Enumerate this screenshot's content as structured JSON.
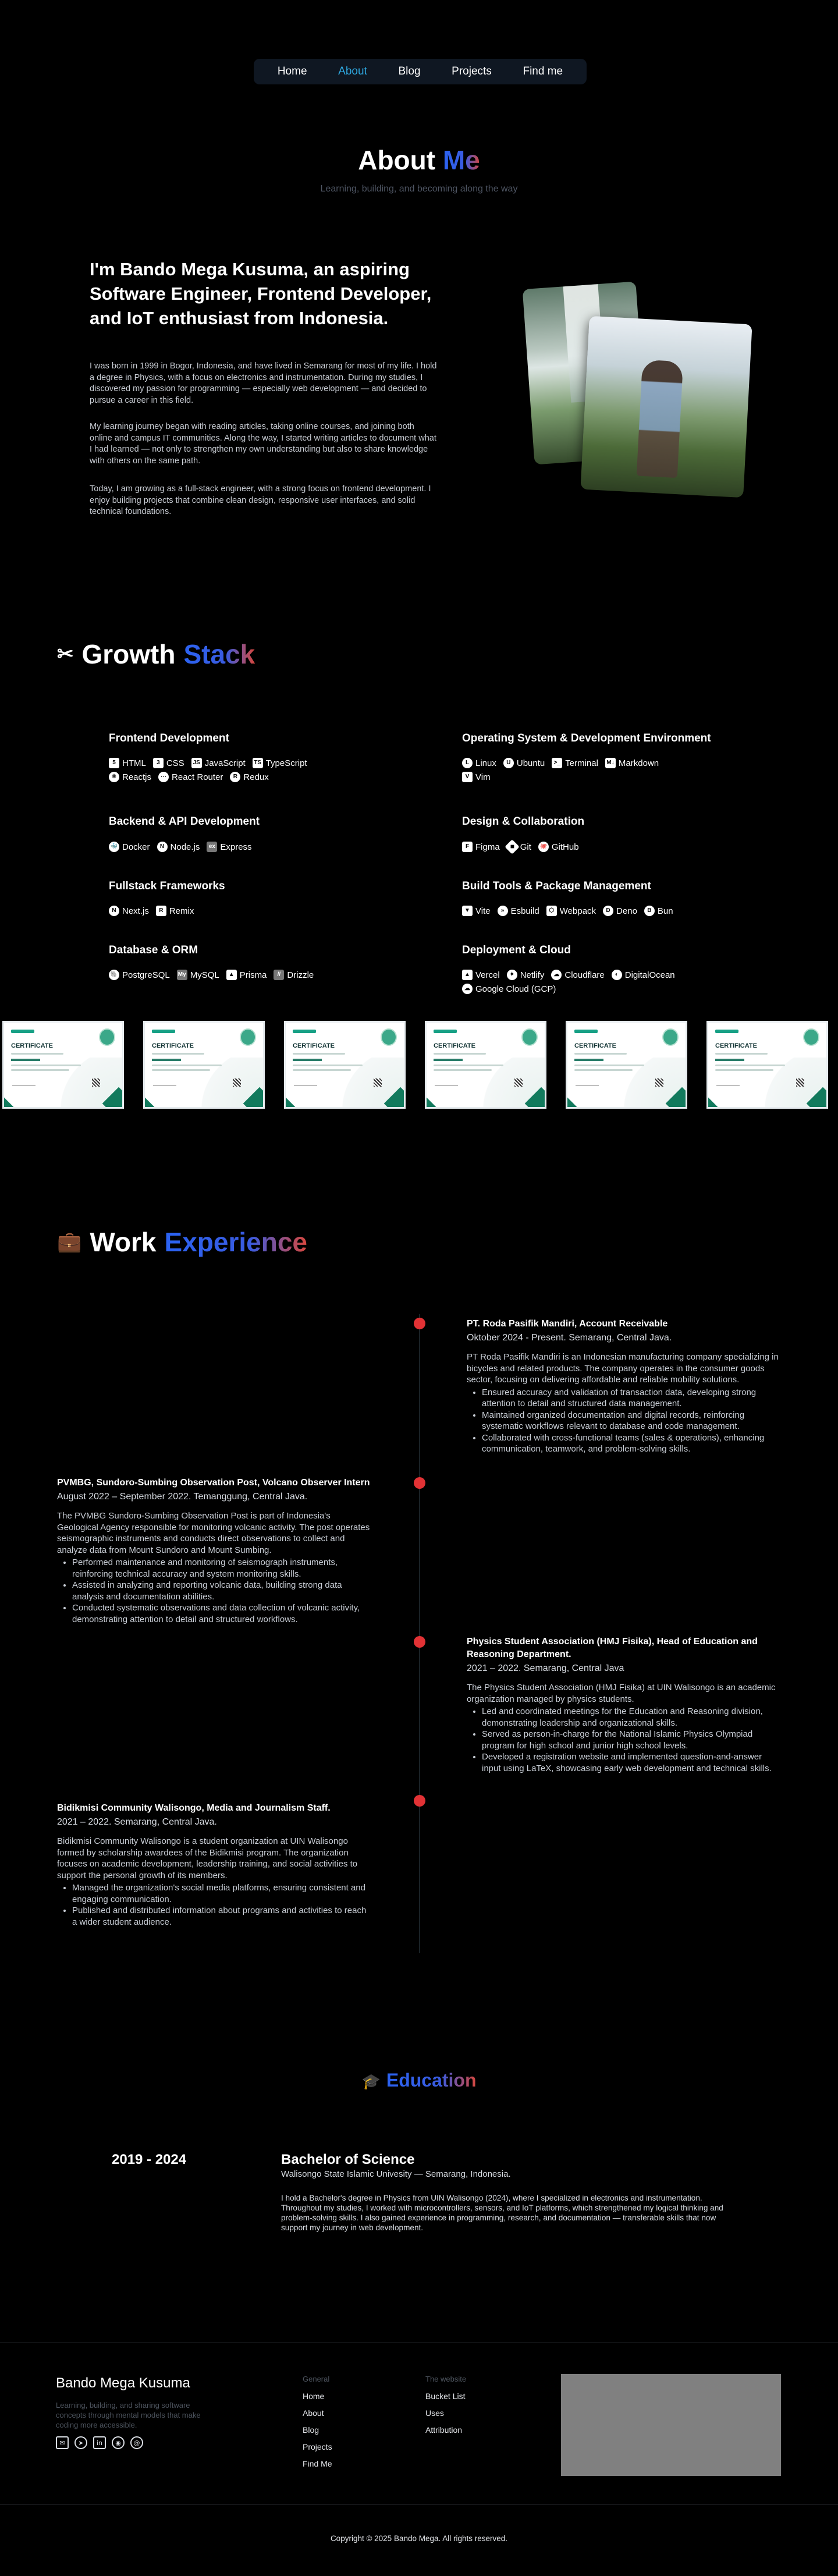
{
  "nav": {
    "items": [
      "Home",
      "About",
      "Blog",
      "Projects",
      "Find me"
    ],
    "active": "About"
  },
  "about": {
    "title_a": "About",
    "title_b": "Me",
    "subtitle": "Learning, building, and becoming along the way",
    "heading": "I'm Bando Mega Kusuma, an aspiring Software Engineer, Frontend Developer, and IoT enthusiast from Indonesia.",
    "paragraphs": [
      "I was born in 1999 in Bogor, Indonesia, and have lived in Semarang for most of my life. I hold a degree in Physics, with a focus on electronics and instrumentation. During my studies, I discovered my passion for programming — especially web development — and decided to pursue a career in this field.",
      "My learning journey began with reading articles, taking online courses, and joining both online and campus IT communities. Along the way, I started writing articles to document what I had learned — not only to strengthen my own understanding but also to share knowledge with others on the same path.",
      "Today, I am growing as a full-stack engineer, with a strong focus on frontend development. I enjoy building projects that combine clean design, responsive user interfaces, and solid technical foundations."
    ]
  },
  "growth": {
    "title_a": "Growth",
    "title_b": "Stack",
    "categories": [
      {
        "name": "Frontend Development",
        "items": [
          "HTML",
          "CSS",
          "JavaScript",
          "TypeScript",
          "Reactjs",
          "React Router",
          "Redux"
        ]
      },
      {
        "name": "Operating System & Development Environment",
        "items": [
          "Linux",
          "Ubuntu",
          "Terminal",
          "Markdown",
          "Vim"
        ]
      },
      {
        "name": "Backend & API Development",
        "items": [
          "Docker",
          "Node.js",
          "Express"
        ]
      },
      {
        "name": "Design & Collaboration",
        "items": [
          "Figma",
          "Git",
          "GitHub"
        ]
      },
      {
        "name": "Fullstack Frameworks",
        "items": [
          "Next.js",
          "Remix"
        ]
      },
      {
        "name": "Build Tools & Package Management",
        "items": [
          "Vite",
          "Esbuild",
          "Webpack",
          "Deno",
          "Bun"
        ]
      },
      {
        "name": "Database & ORM",
        "items": [
          "PostgreSQL",
          "MySQL",
          "Prisma",
          "Drizzle"
        ]
      },
      {
        "name": "Deployment & Cloud",
        "items": [
          "Vercel",
          "Netlify",
          "Cloudflare",
          "DigitalOcean",
          "Google Cloud (GCP)"
        ]
      }
    ],
    "certificate_label": "CERTIFICATE"
  },
  "work": {
    "title_a": "Work",
    "title_b": "Experience",
    "jobs": [
      {
        "title": "PT. Roda Pasifik Mandiri, Account Receivable",
        "date": "Oktober 2024 - Present. Semarang, Central Java.",
        "desc": "PT Roda Pasifik Mandiri is an Indonesian manufacturing company specializing in bicycles and related products. The company operates in the consumer goods sector, focusing on delivering affordable and reliable mobility solutions.",
        "bullets": [
          "Ensured accuracy and validation of transaction data, developing strong attention to detail and structured data management.",
          "Maintained organized documentation and digital records, reinforcing systematic workflows relevant to database and code management.",
          "Collaborated with cross-functional teams (sales & operations), enhancing communication, teamwork, and problem-solving skills."
        ]
      },
      {
        "title": "PVMBG, Sundoro-Sumbing Observation Post, Volcano Observer Intern",
        "date": "August 2022 – September 2022. Temanggung, Central Java.",
        "desc": "The PVMBG Sundoro-Sumbing Observation Post is part of Indonesia's Geological Agency responsible for monitoring volcanic activity. The post operates seismographic instruments and conducts direct observations to collect and analyze data from Mount Sundoro and Mount Sumbing.",
        "bullets": [
          "Performed maintenance and monitoring of seismograph instruments, reinforcing technical accuracy and system monitoring skills.",
          "Assisted in analyzing and reporting volcanic data, building strong data analysis and documentation abilities.",
          "Conducted systematic observations and data collection of volcanic activity, demonstrating attention to detail and structured workflows."
        ]
      },
      {
        "title": "Physics Student Association (HMJ Fisika), Head of Education and Reasoning Department.",
        "date": "2021 – 2022. Semarang, Central Java",
        "desc": "The Physics Student Association (HMJ Fisika) at UIN Walisongo is an academic organization managed by physics students.",
        "bullets": [
          "Led and coordinated meetings for the Education and Reasoning division, demonstrating leadership and organizational skills.",
          "Served as person-in-charge for the National Islamic Physics Olympiad program for high school and junior high school levels.",
          "Developed a registration website and implemented question-and-answer input using LaTeX, showcasing early web development and technical skills."
        ]
      },
      {
        "title": "Bidikmisi Community Walisongo, Media and Journalism Staff.",
        "date": "2021 – 2022. Semarang, Central Java.",
        "desc": "Bidikmisi Community Walisongo is a student organization at UIN Walisongo formed by scholarship awardees of the Bidikmisi program. The organization focuses on academic development, leadership training, and social activities to support the personal growth of its members.",
        "bullets": [
          "Managed the organization's social media platforms, ensuring consistent and engaging communication.",
          "Published and distributed information about programs and activities to reach a wider student audience."
        ]
      }
    ]
  },
  "education": {
    "title": "Education",
    "years": "2019 - 2024",
    "degree": "Bachelor of Science",
    "school": "Walisongo State Islamic Univesity — Semarang, Indonesia.",
    "desc": "I hold a Bachelor's degree in Physics from UIN Walisongo (2024), where I specialized in electronics and instrumentation. Throughout my studies, I worked with microcontrollers, sensors, and IoT platforms, which strengthened my logical thinking and problem-solving skills. I also gained experience in programming, research, and documentation — transferable skills that now support my journey in web development."
  },
  "footer": {
    "name": "Bando Mega Kusuma",
    "tagline": "Learning, building, and sharing software concepts through mental models that make coding more accessible.",
    "general_heading": "General",
    "general_links": [
      "Home",
      "About",
      "Blog",
      "Projects",
      "Find Me"
    ],
    "website_heading": "The website",
    "website_links": [
      "Bucket List",
      "Uses",
      "Attribution"
    ],
    "copyright": "Copyright © 2025 Bando Mega. All rights reserved."
  },
  "colors": {
    "accent_blue": "#2b63f2",
    "accent_red": "#d9473c",
    "nav_active": "#2ea8e0",
    "timeline_dot": "#e23235"
  }
}
